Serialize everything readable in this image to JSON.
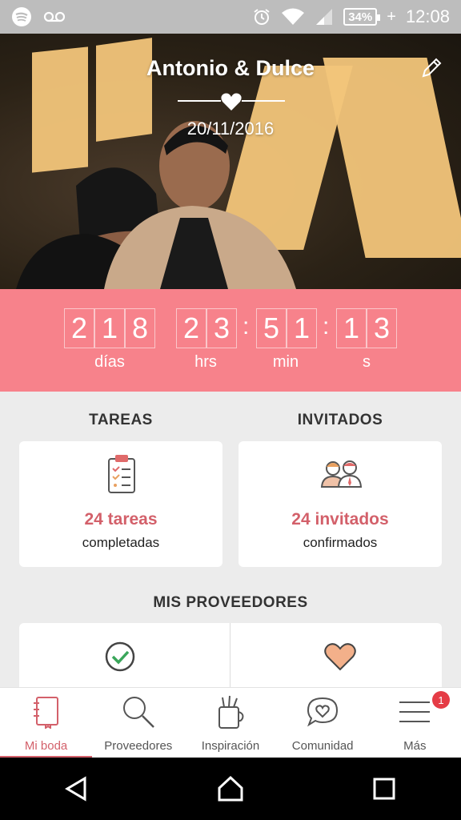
{
  "status": {
    "battery": "34%",
    "time": "12:08",
    "icons": [
      "spotify-icon",
      "voicemail-icon",
      "alarm-icon",
      "wifi-icon",
      "signal-icon",
      "battery-icon",
      "charging-icon"
    ]
  },
  "hero": {
    "title": "Antonio & Dulce",
    "date": "20/11/2016",
    "edit_icon": "pencil-icon"
  },
  "countdown": {
    "days": [
      "2",
      "1",
      "8"
    ],
    "hours": [
      "2",
      "3"
    ],
    "minutes": [
      "5",
      "1"
    ],
    "seconds": [
      "1",
      "3"
    ],
    "separator": ":",
    "labels": {
      "days": "días",
      "hours": "hrs",
      "minutes": "min",
      "seconds": "s"
    }
  },
  "cards": {
    "tareas": {
      "title": "TAREAS",
      "metric": "24 tareas",
      "sub": "completadas",
      "icon": "clipboard-icon"
    },
    "invitados": {
      "title": "INVITADOS",
      "metric": "24 invitados",
      "sub": "confirmados",
      "icon": "guests-icon"
    }
  },
  "providers": {
    "title": "MIS PROVEEDORES",
    "icons": [
      "check-circle-icon",
      "heart-icon"
    ]
  },
  "tabs": [
    {
      "label": "Mi boda",
      "icon": "notebook-icon",
      "active": true
    },
    {
      "label": "Proveedores",
      "icon": "search-icon",
      "active": false
    },
    {
      "label": "Inspiración",
      "icon": "jar-icon",
      "active": false
    },
    {
      "label": "Comunidad",
      "icon": "chat-heart-icon",
      "active": false
    },
    {
      "label": "Más",
      "icon": "menu-icon",
      "active": false,
      "badge": "1"
    }
  ],
  "colors": {
    "accent": "#d3606a",
    "countdown_bg": "#f7828b",
    "badge": "#e53c46"
  }
}
